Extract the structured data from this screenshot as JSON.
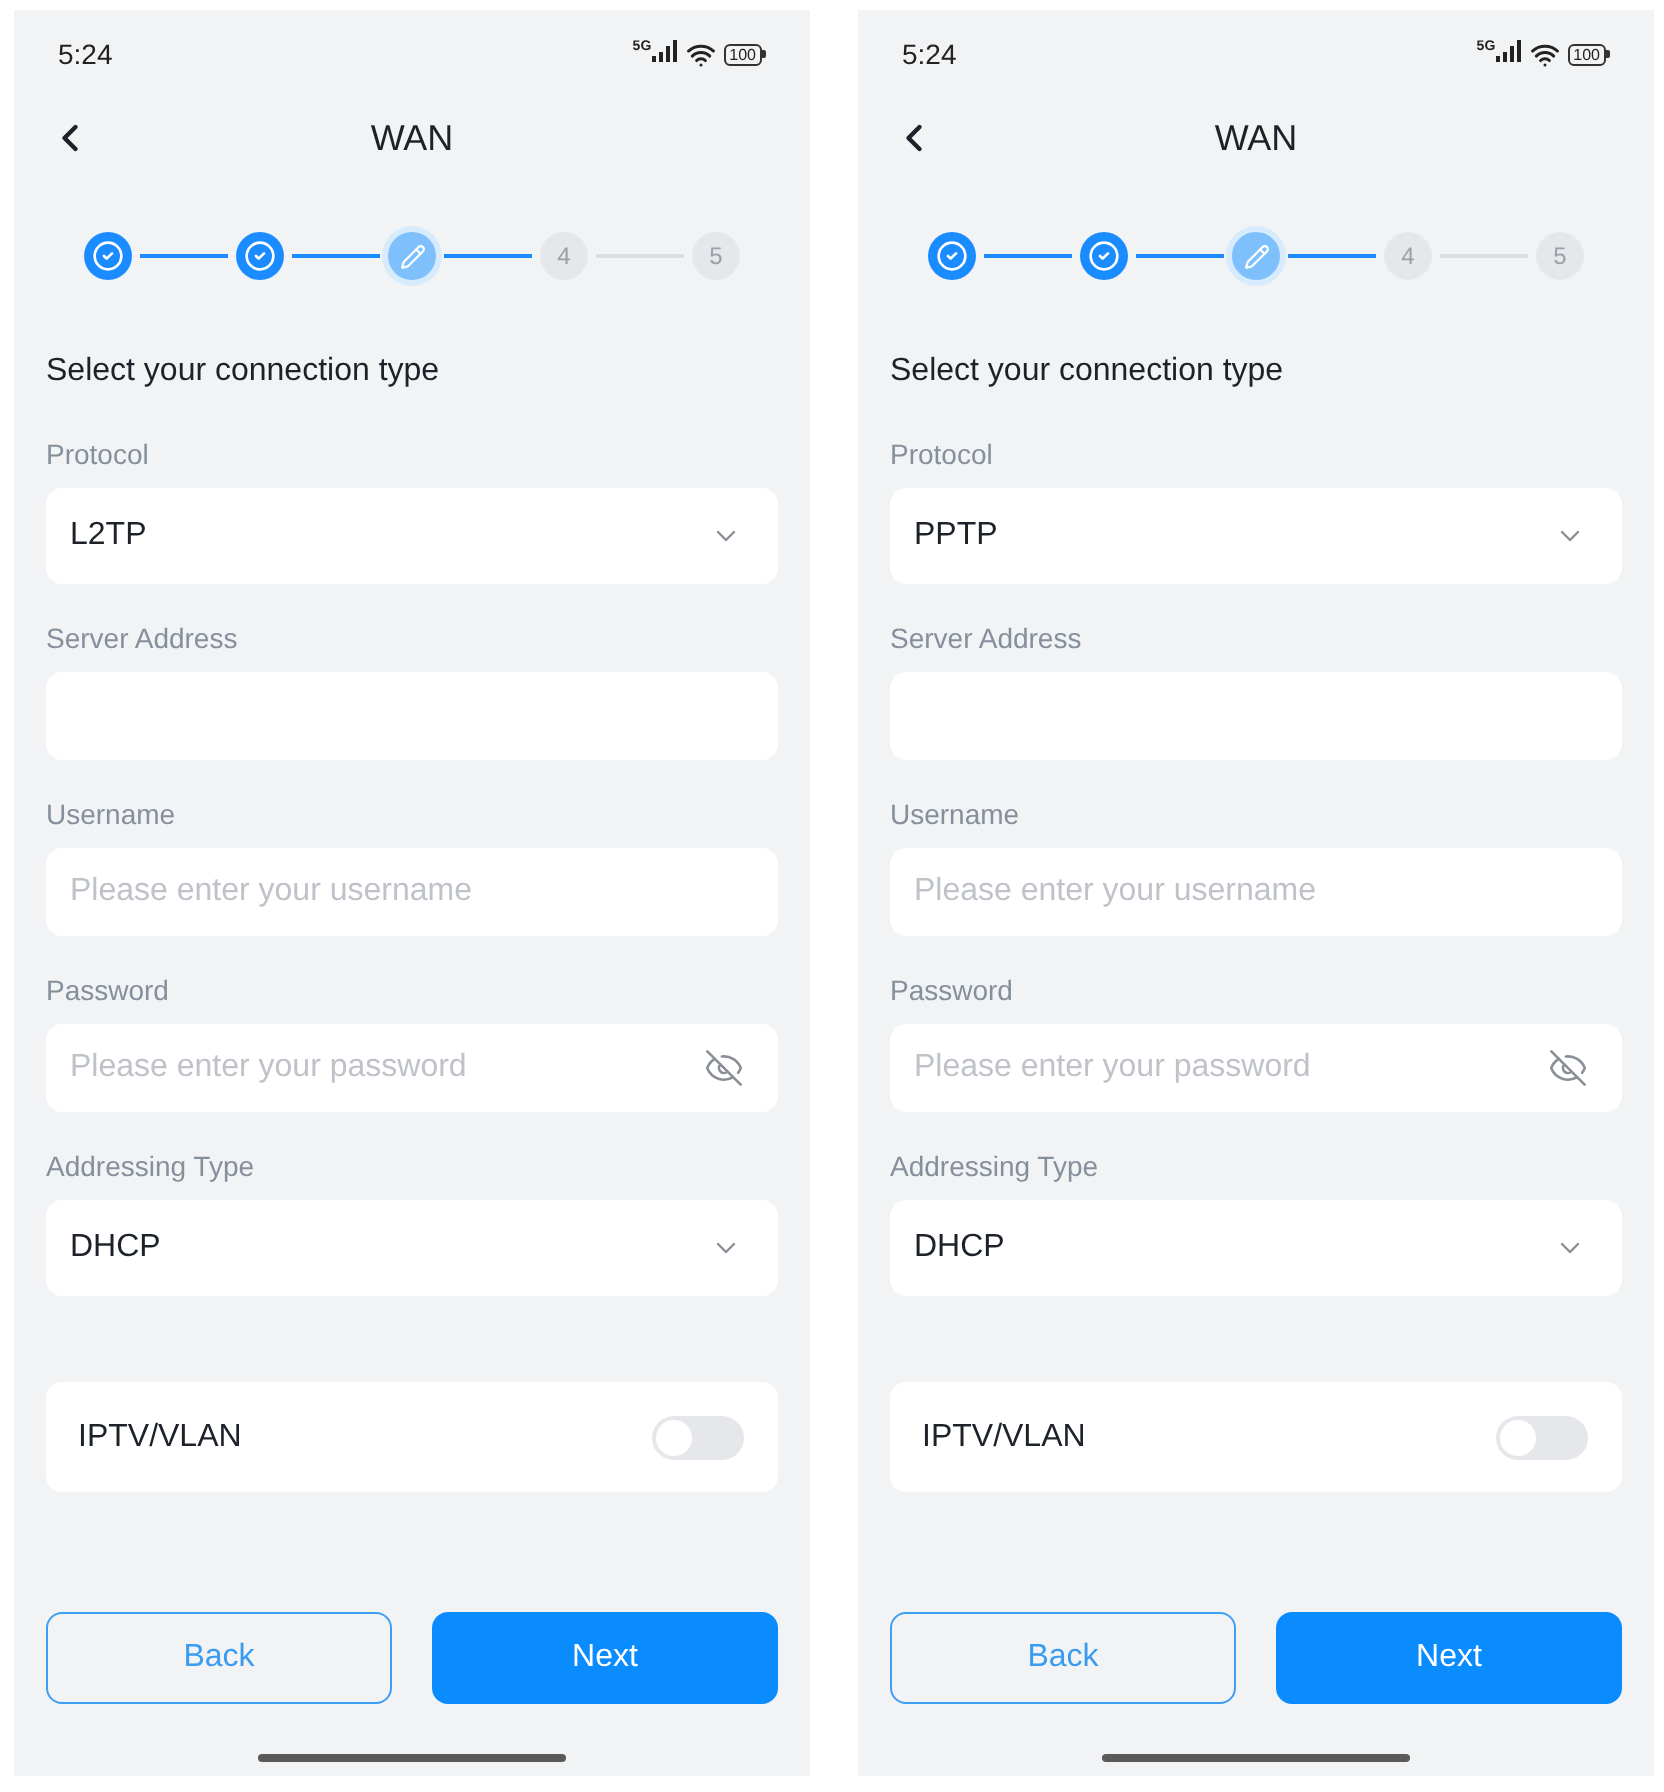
{
  "screens": [
    {
      "status_bar": {
        "time": "5:24",
        "network": "5G",
        "battery": "100"
      },
      "header": {
        "title": "WAN"
      },
      "stepper": {
        "steps": [
          {
            "kind": "done"
          },
          {
            "kind": "done"
          },
          {
            "kind": "current"
          },
          {
            "kind": "pending",
            "label": "4"
          },
          {
            "kind": "pending",
            "label": "5"
          }
        ]
      },
      "section_title": "Select your connection type",
      "fields": [
        {
          "kind": "select",
          "label": "Protocol",
          "value": "L2TP"
        },
        {
          "kind": "text",
          "label": "Server Address"
        },
        {
          "kind": "text",
          "label": "Username",
          "placeholder": "Please enter your username"
        },
        {
          "kind": "password",
          "label": "Password",
          "placeholder": "Please enter your password"
        },
        {
          "kind": "select",
          "label": "Addressing Type",
          "value": "DHCP"
        }
      ],
      "iptv": {
        "label": "IPTV/VLAN",
        "on": false
      },
      "buttons": [
        {
          "kind": "secondary",
          "label": "Back"
        },
        {
          "kind": "primary",
          "label": "Next"
        }
      ]
    },
    {
      "status_bar": {
        "time": "5:24",
        "network": "5G",
        "battery": "100"
      },
      "header": {
        "title": "WAN"
      },
      "stepper": {
        "steps": [
          {
            "kind": "done"
          },
          {
            "kind": "done"
          },
          {
            "kind": "current"
          },
          {
            "kind": "pending",
            "label": "4"
          },
          {
            "kind": "pending",
            "label": "5"
          }
        ]
      },
      "section_title": "Select your connection type",
      "fields": [
        {
          "kind": "select",
          "label": "Protocol",
          "value": "PPTP"
        },
        {
          "kind": "text",
          "label": "Server Address"
        },
        {
          "kind": "text",
          "label": "Username",
          "placeholder": "Please enter your username"
        },
        {
          "kind": "password",
          "label": "Password",
          "placeholder": "Please enter your password"
        },
        {
          "kind": "select",
          "label": "Addressing Type",
          "value": "DHCP"
        }
      ],
      "iptv": {
        "label": "IPTV/VLAN",
        "on": false
      },
      "buttons": [
        {
          "kind": "secondary",
          "label": "Back"
        },
        {
          "kind": "primary",
          "label": "Next"
        }
      ]
    }
  ]
}
